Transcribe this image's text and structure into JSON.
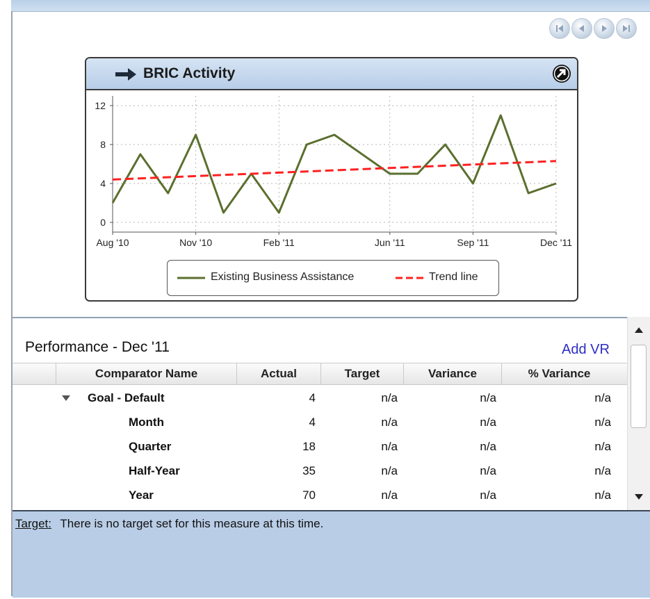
{
  "nav": {
    "buttons": [
      {
        "name": "first-page-button",
        "icon": "first-icon"
      },
      {
        "name": "prev-page-button",
        "icon": "prev-icon"
      },
      {
        "name": "next-page-button",
        "icon": "next-icon"
      },
      {
        "name": "last-page-button",
        "icon": "last-icon"
      }
    ]
  },
  "chart_panel": {
    "title": "BRIC Activity",
    "title_icon": "arrow-right-icon",
    "expand_icon": "expand-arrow-icon"
  },
  "chart_data": {
    "type": "line",
    "x": [
      "Aug '10",
      "Sep '10",
      "Oct '10",
      "Nov '10",
      "Dec '10",
      "Jan '11",
      "Feb '11",
      "Mar '11",
      "Apr '11",
      "May '11",
      "Jun '11",
      "Jul '11",
      "Aug '11",
      "Sep '11",
      "Oct '11",
      "Nov '11",
      "Dec '11"
    ],
    "x_tick_labels": [
      "Aug '10",
      "Nov '10",
      "Feb '11",
      "Jun '11",
      "Sep '11",
      "Dec '11"
    ],
    "ylim": [
      -1,
      13
    ],
    "y_ticks": [
      0,
      4,
      8,
      12
    ],
    "grid": true,
    "legend": "bottom",
    "series": [
      {
        "name": "Existing Business Assistance",
        "color": "#5b6f2e",
        "dash": "solid",
        "points": [
          {
            "x": "Aug '10",
            "y": 2
          },
          {
            "x": "Sep '10",
            "y": 7
          },
          {
            "x": "Oct '10",
            "y": 3
          },
          {
            "x": "Nov '10",
            "y": 9
          },
          {
            "x": "Dec '10",
            "y": 1
          },
          {
            "x": "Jan '11",
            "y": 5
          },
          {
            "x": "Feb '11",
            "y": 1
          },
          {
            "x": "Mar '11",
            "y": 8
          },
          {
            "x": "Apr '11",
            "y": 9
          },
          {
            "x": "Jun '11",
            "y": 5
          },
          {
            "x": "Jul '11",
            "y": 5
          },
          {
            "x": "Aug '11",
            "y": 8
          },
          {
            "x": "Sep '11",
            "y": 4
          },
          {
            "x": "Oct '11",
            "y": 11
          },
          {
            "x": "Nov '11",
            "y": 3
          },
          {
            "x": "Dec '11",
            "y": 4
          }
        ]
      },
      {
        "name": "Trend line",
        "color": "#ff2020",
        "dash": "dashed",
        "points": [
          {
            "x": "Aug '10",
            "y": 4.4
          },
          {
            "x": "Dec '11",
            "y": 6.3
          }
        ]
      }
    ]
  },
  "performance": {
    "title": "Performance  -  Dec '11",
    "add_vr": "Add VR",
    "columns": [
      "Comparator Name",
      "Actual",
      "Target",
      "Variance",
      "% Variance"
    ],
    "rows": [
      {
        "name": "Goal - Default",
        "actual": "4",
        "target": "n/a",
        "variance": "n/a",
        "pct": "n/a",
        "group": true
      },
      {
        "name": "Month",
        "actual": "4",
        "target": "n/a",
        "variance": "n/a",
        "pct": "n/a"
      },
      {
        "name": "Quarter",
        "actual": "18",
        "target": "n/a",
        "variance": "n/a",
        "pct": "n/a"
      },
      {
        "name": "Half-Year",
        "actual": "35",
        "target": "n/a",
        "variance": "n/a",
        "pct": "n/a"
      },
      {
        "name": "Year",
        "actual": "70",
        "target": "n/a",
        "variance": "n/a",
        "pct": "n/a"
      }
    ]
  },
  "footer": {
    "label": "Target:",
    "text": "There is no target set for this measure at this time."
  }
}
